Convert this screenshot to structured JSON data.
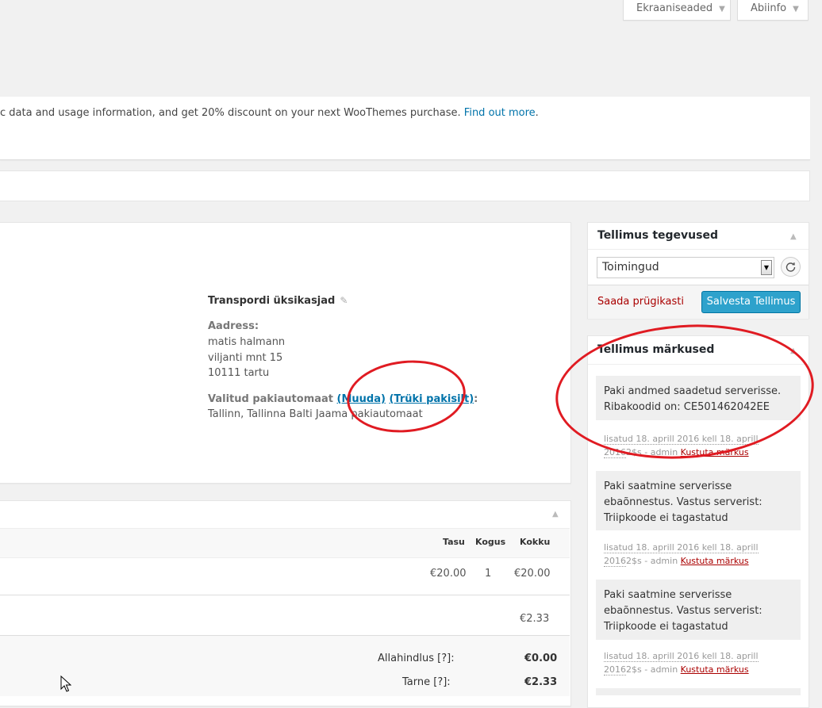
{
  "screen_tabs": {
    "screen_options": "Ekraaniseaded",
    "help": "Abiinfo"
  },
  "notice": {
    "text": "c data and usage information, and get 20% discount on your next WooThemes purchase.",
    "link": "Find out more",
    "end": "."
  },
  "shipping": {
    "title": "Transpordi üksikasjad",
    "address_label": "Aadress:",
    "address_lines": [
      "matis halmann",
      "viljanti mnt 15",
      "10111 tartu"
    ],
    "terminal_label": "Valitud pakiautomaat",
    "change_link": "(Muuda)",
    "print_link": "(Trüki pakisilt)",
    "colon": ":",
    "terminal_value": "Tallinn, Tallinna Balti Jaama pakiautomaat"
  },
  "items": {
    "headers": {
      "cost": "Tasu",
      "qty": "Kogus",
      "total": "Kokku"
    },
    "row": {
      "cost": "€20.00",
      "qty": "1",
      "total": "€20.00"
    },
    "shipping_row": {
      "total": "€2.33"
    },
    "totals": [
      {
        "label": "Allahindlus [?]:",
        "value": "€0.00"
      },
      {
        "label": "Tarne [?]:",
        "value": "€2.33"
      }
    ]
  },
  "actions": {
    "title": "Tellimus tegevused",
    "select_value": "Toimingud",
    "trash": "Saada prügikasti",
    "save": "Salvesta Tellimus"
  },
  "notes": {
    "title": "Tellimus märkused",
    "list": [
      {
        "text": "Paki andmed saadetud serverisse. Ribakoodid on: CE501462042EE",
        "meta": "lisatud 18. aprill 2016 kell 18. aprill 2016",
        "meta_suffix": "2$s",
        "author": "- admin",
        "delete": "Kustuta märkus"
      },
      {
        "text": "Paki saatmine serverisse ebaõnnestus. Vastus serverist: Triipkoode ei tagastatud",
        "meta": "lisatud 18. aprill 2016 kell 18. aprill 2016",
        "meta_suffix": "2$s",
        "author": "- admin",
        "delete": "Kustuta märkus"
      },
      {
        "text": "Paki saatmine serverisse ebaõnnestus. Vastus serverist: Triipkoode ei tagastatud",
        "meta": "lisatud 18. aprill 2016 kell 18. aprill 2016",
        "meta_suffix": "2$s",
        "author": "- admin",
        "delete": "Kustuta märkus"
      }
    ]
  },
  "colors": {
    "accent": "#0073aa",
    "button": "#2ea2cc",
    "danger": "#aa0000",
    "annotation": "#e01b22"
  }
}
